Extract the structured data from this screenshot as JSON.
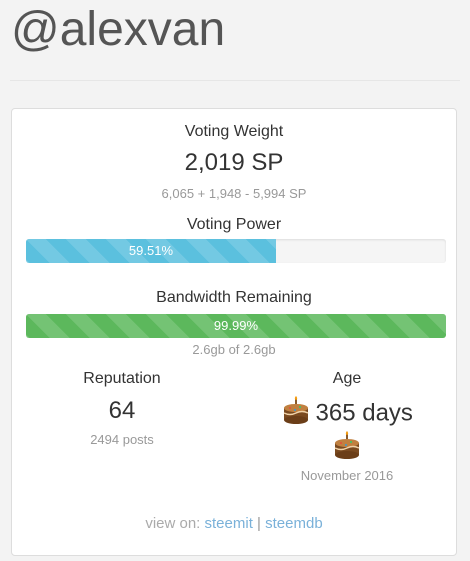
{
  "profile": {
    "username": "@alexvan"
  },
  "voting_weight": {
    "label": "Voting Weight",
    "value": "2,019 SP",
    "breakdown": "6,065 + 1,948 - 5,994 SP"
  },
  "voting_power": {
    "label": "Voting Power",
    "percent_text": "59.51%",
    "fraction": 0.5951,
    "color": "#5bc0de"
  },
  "bandwidth": {
    "label": "Bandwidth Remaining",
    "percent_text": "99.99%",
    "fraction": 0.9999,
    "detail": "2.6gb of 2.6gb",
    "color": "#5cb85c"
  },
  "reputation": {
    "label": "Reputation",
    "value": "64",
    "posts": "2494 posts"
  },
  "age": {
    "label": "Age",
    "value": "365 days",
    "since": "November 2016",
    "icon": "birthday-cake-icon"
  },
  "footer": {
    "prefix": "view on:",
    "link1": "steemit",
    "separator": "|",
    "link2": "steemdb"
  }
}
